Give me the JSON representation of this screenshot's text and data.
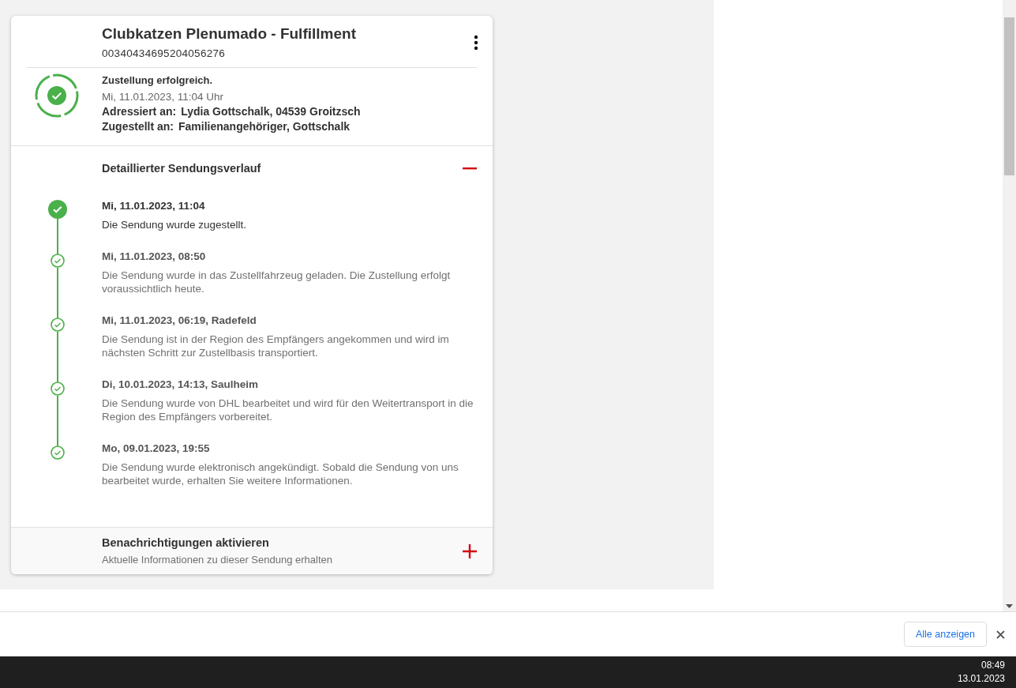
{
  "shipment": {
    "title": "Clubkatzen Plenumado - Fulfillment",
    "tracking_number": "00340434695204056276",
    "status": {
      "headline": "Zustellung erfolgreich.",
      "datetime": "Mi, 11.01.2023, 11:04 Uhr",
      "lines": [
        {
          "label": "Adressiert an:",
          "value": "Lydia Gottschalk, 04539 Groitzsch"
        },
        {
          "label": "Zugestellt an:",
          "value": "Familienangehöriger, Gottschalk"
        }
      ]
    }
  },
  "history": {
    "title": "Detaillierter Sendungsverlauf",
    "expanded": true,
    "events": [
      {
        "kind": "current",
        "datetime": "Mi, 11.01.2023, 11:04",
        "text": "Die Sendung wurde zugestellt."
      },
      {
        "kind": "done",
        "datetime": "Mi, 11.01.2023, 08:50",
        "text": "Die Sendung wurde in das Zustellfahrzeug geladen. Die Zustellung erfolgt voraussichtlich heute."
      },
      {
        "kind": "done",
        "datetime": "Mi, 11.01.2023, 06:19, Radefeld",
        "text": "Die Sendung ist in der Region des Empfängers angekommen und wird im nächsten Schritt zur Zustellbasis transportiert."
      },
      {
        "kind": "done",
        "datetime": "Di, 10.01.2023, 14:13, Saulheim",
        "text": "Die Sendung wurde von DHL bearbeitet und wird für den Weitertransport in die Region des Empfängers vorbereitet."
      },
      {
        "kind": "done",
        "datetime": "Mo, 09.01.2023, 19:55",
        "text": "Die Sendung wurde elektronisch angekündigt. Sobald die Sendung von uns bearbeitet wurde, erhalten Sie weitere Informationen."
      }
    ]
  },
  "notifications": {
    "title": "Benachrichtigungen aktivieren",
    "subtitle": "Aktuelle Informationen zu dieser Sendung erhalten",
    "expanded": false
  },
  "download_bar": {
    "button": "Alle anzeigen"
  },
  "taskbar": {
    "time": "08:49",
    "date": "13.01.2023"
  }
}
